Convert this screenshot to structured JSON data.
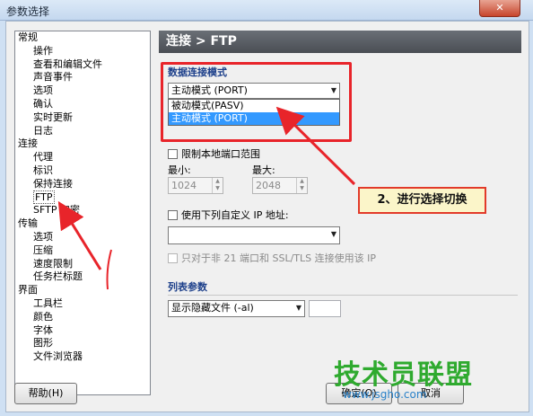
{
  "window": {
    "title": "参数选择",
    "close_glyph": "✕"
  },
  "tree": {
    "items": [
      {
        "label": "常规",
        "level": 0
      },
      {
        "label": "操作",
        "level": 1
      },
      {
        "label": "查看和编辑文件",
        "level": 1
      },
      {
        "label": "声音事件",
        "level": 1
      },
      {
        "label": "选项",
        "level": 1
      },
      {
        "label": "确认",
        "level": 1
      },
      {
        "label": "实时更新",
        "level": 1
      },
      {
        "label": "日志",
        "level": 1
      },
      {
        "label": "连接",
        "level": 0
      },
      {
        "label": "代理",
        "level": 1
      },
      {
        "label": "标识",
        "level": 1
      },
      {
        "label": "保持连接",
        "level": 1
      },
      {
        "label": "FTP",
        "level": 1,
        "selected": true
      },
      {
        "label": "SFTP 加密",
        "level": 1
      },
      {
        "label": "传输",
        "level": 0
      },
      {
        "label": "选项",
        "level": 1
      },
      {
        "label": "压缩",
        "level": 1
      },
      {
        "label": "速度限制",
        "level": 1
      },
      {
        "label": "任务栏标题",
        "level": 1
      },
      {
        "label": "界面",
        "level": 0
      },
      {
        "label": "工具栏",
        "level": 1
      },
      {
        "label": "颜色",
        "level": 1
      },
      {
        "label": "字体",
        "level": 1
      },
      {
        "label": "图形",
        "level": 1
      },
      {
        "label": "文件浏览器",
        "level": 1
      }
    ]
  },
  "panel": {
    "header": "连接 > FTP",
    "data_connection": {
      "title": "数据连接模式",
      "selected": "主动模式 (PORT)",
      "options": [
        "被动模式(PASV)",
        "主动模式 (PORT)"
      ],
      "highlighted_index": 1
    },
    "port_range": {
      "checkbox_label": "限制本地端口范围",
      "min_label": "最小:",
      "max_label": "最大:",
      "min_value": "1024",
      "max_value": "2048"
    },
    "custom_ip": {
      "checkbox_label": "使用下列自定义 IP 地址:",
      "value": ""
    },
    "only_non21_label": "只对于非 21 端口和 SSL/TLS 连接使用该 IP",
    "list_params": {
      "title": "列表参数",
      "selected": "显示隐藏文件 (-al)",
      "extra_value": ""
    }
  },
  "buttons": {
    "help": "帮助(H)",
    "ok": "确定(O)",
    "cancel": "取消"
  },
  "annotation": {
    "callout": "2、进行选择切换",
    "accent": "#e8242a"
  },
  "watermark": {
    "text": "技术员联盟",
    "url": "www.jsgho.com"
  }
}
